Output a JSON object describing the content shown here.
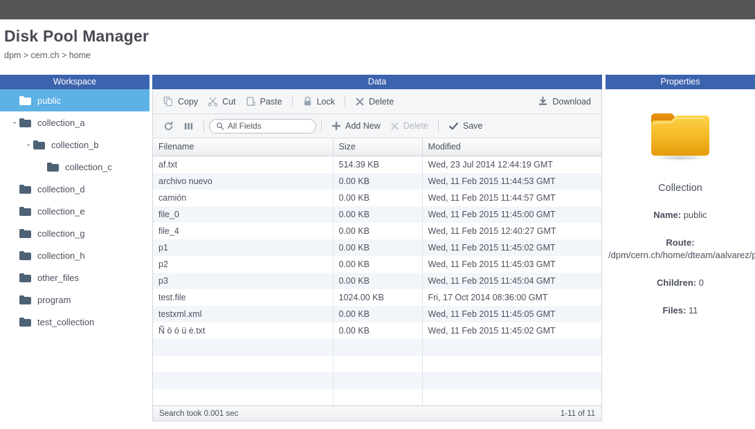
{
  "app": {
    "title": "Disk Pool Manager",
    "breadcrumb": "dpm > cern.ch > home"
  },
  "workspace": {
    "header": "Workspace",
    "items": [
      {
        "label": "public",
        "indent": 0,
        "toggle": "",
        "selected": true
      },
      {
        "label": "collection_a",
        "indent": 0,
        "toggle": "-",
        "selected": false
      },
      {
        "label": "collection_b",
        "indent": 1,
        "toggle": "-",
        "selected": false
      },
      {
        "label": "collection_c",
        "indent": 2,
        "toggle": "",
        "selected": false
      },
      {
        "label": "collection_d",
        "indent": 0,
        "toggle": "",
        "selected": false
      },
      {
        "label": "collection_e",
        "indent": 0,
        "toggle": "",
        "selected": false
      },
      {
        "label": "collection_g",
        "indent": 0,
        "toggle": "",
        "selected": false
      },
      {
        "label": "collection_h",
        "indent": 0,
        "toggle": "",
        "selected": false
      },
      {
        "label": "other_files",
        "indent": 0,
        "toggle": "",
        "selected": false
      },
      {
        "label": "program",
        "indent": 0,
        "toggle": "",
        "selected": false
      },
      {
        "label": "test_collection",
        "indent": 0,
        "toggle": "",
        "selected": false
      }
    ]
  },
  "data": {
    "header": "Data",
    "toolbar_primary": {
      "copy": "Copy",
      "cut": "Cut",
      "paste": "Paste",
      "lock": "Lock",
      "delete": "Delete",
      "download": "Download"
    },
    "toolbar_secondary": {
      "refresh_icon": "refresh-icon",
      "columns_icon": "columns-icon",
      "search_placeholder": "All Fields",
      "search_value": "",
      "add_new": "Add New",
      "delete": "Delete",
      "delete_disabled": true,
      "save": "Save"
    },
    "columns": [
      "Filename",
      "Size",
      "Modified"
    ],
    "rows": [
      {
        "filename": "af.txt",
        "size": "514.39 KB",
        "modified": "Wed, 23 Jul 2014 12:44:19 GMT"
      },
      {
        "filename": "archivo nuevo",
        "size": "0.00 KB",
        "modified": "Wed, 11 Feb 2015 11:44:53 GMT"
      },
      {
        "filename": "camión",
        "size": "0.00 KB",
        "modified": "Wed, 11 Feb 2015 11:44:57 GMT"
      },
      {
        "filename": "file_0",
        "size": "0.00 KB",
        "modified": "Wed, 11 Feb 2015 11:45:00 GMT"
      },
      {
        "filename": "file_4",
        "size": "0.00 KB",
        "modified": "Wed, 11 Feb 2015 12:40:27 GMT"
      },
      {
        "filename": "p1",
        "size": "0.00 KB",
        "modified": "Wed, 11 Feb 2015 11:45:02 GMT"
      },
      {
        "filename": "p2",
        "size": "0.00 KB",
        "modified": "Wed, 11 Feb 2015 11:45:03 GMT"
      },
      {
        "filename": "p3",
        "size": "0.00 KB",
        "modified": "Wed, 11 Feb 2015 11:45:04 GMT"
      },
      {
        "filename": "test.file",
        "size": "1024.00 KB",
        "modified": "Fri, 17 Oct 2014 08:36:00 GMT"
      },
      {
        "filename": "testxml.xml",
        "size": "0.00 KB",
        "modified": "Wed, 11 Feb 2015 11:45:05 GMT"
      },
      {
        "filename": "Ñ ö ó ü ė.txt",
        "size": "0.00 KB",
        "modified": "Wed, 11 Feb 2015 11:45:02 GMT"
      },
      {
        "filename": "",
        "size": "",
        "modified": ""
      },
      {
        "filename": "",
        "size": "",
        "modified": ""
      },
      {
        "filename": "",
        "size": "",
        "modified": ""
      },
      {
        "filename": "",
        "size": "",
        "modified": ""
      }
    ],
    "status": {
      "search_time": "Search took 0.001 sec",
      "pagination": "1-11 of 11"
    }
  },
  "properties": {
    "header": "Properties",
    "icon": "folder-icon",
    "type": "Collection",
    "name_label": "Name:",
    "name_value": "public",
    "route_label": "Route:",
    "route_value": "/dpm/cern.ch/home/dteam/aalvarez/public/",
    "children_label": "Children:",
    "children_value": "0",
    "files_label": "Files:",
    "files_value": "11"
  },
  "colors": {
    "topbar": "#555555",
    "panel_header": "#3c63ad",
    "selection": "#5cb1e5",
    "folder_small": "#4e6275",
    "folder_large": "#f0b429",
    "row_alt": "#f2f6fb"
  }
}
